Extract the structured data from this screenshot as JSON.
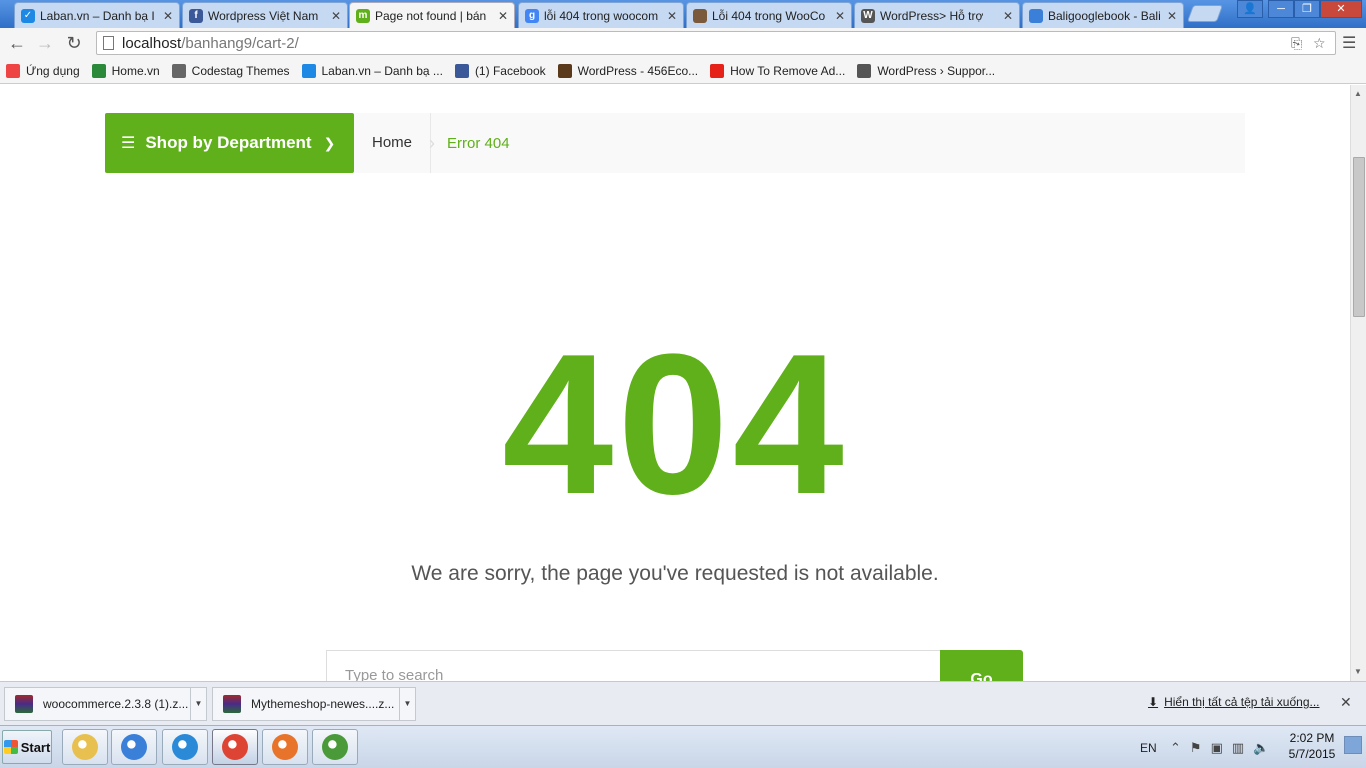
{
  "browser": {
    "tabs": [
      {
        "label": "Laban.vn – Danh bạ I",
        "active": false,
        "icon": "laban-icon",
        "color": "#1e88e5",
        "glyph": "✓"
      },
      {
        "label": "Wordpress Việt Nam",
        "active": false,
        "icon": "facebook-icon",
        "color": "#3b5998",
        "glyph": "f"
      },
      {
        "label": "Page not found | bán",
        "active": true,
        "icon": "m-icon",
        "color": "#5fb01a",
        "glyph": "m"
      },
      {
        "label": "lỗi 404 trong woocom",
        "active": false,
        "icon": "google-icon",
        "color": "#4285f4",
        "glyph": "g"
      },
      {
        "label": "Lỗi 404 trong WooCo",
        "active": false,
        "icon": "avatar-icon",
        "color": "#7a5a3a",
        "glyph": ""
      },
      {
        "label": "WordPress> Hỗ trợ",
        "active": false,
        "icon": "wordpress-icon",
        "color": "#555555",
        "glyph": "W"
      },
      {
        "label": "Baligooglebook - Bali",
        "active": false,
        "icon": "loading-icon",
        "color": "#3a7fd8",
        "glyph": ""
      }
    ],
    "url_host": "localhost",
    "url_path": "/banhang9/cart-2/",
    "bookmarks": [
      {
        "label": "Ứng dụng",
        "icon": "apps-grid-icon",
        "color": "#e44"
      },
      {
        "label": "Home.vn",
        "icon": "home-vn-icon",
        "color": "#2a8a3a"
      },
      {
        "label": "Codestag Themes",
        "icon": "codestag-icon",
        "color": "#666666"
      },
      {
        "label": "Laban.vn – Danh bạ ...",
        "icon": "laban-icon",
        "color": "#1e88e5"
      },
      {
        "label": "(1) Facebook",
        "icon": "facebook-icon",
        "color": "#3b5998"
      },
      {
        "label": "WordPress - 456Eco...",
        "icon": "wordpress-456-icon",
        "color": "#5a3a1a"
      },
      {
        "label": "How To Remove Ad...",
        "icon": "youtube-icon",
        "color": "#e62117"
      },
      {
        "label": "WordPress › Suppor...",
        "icon": "wordpress-icon",
        "color": "#555555"
      }
    ]
  },
  "page": {
    "department_button": "Shop by Department",
    "breadcrumb_home": "Home",
    "breadcrumb_current": "Error 404",
    "error_code": "404",
    "message": "We are sorry, the page you've requested is not available.",
    "search_placeholder": "Type to search",
    "search_button": "Go",
    "accent_color": "#5fb01a"
  },
  "downloads": {
    "items": [
      {
        "label": "woocommerce.2.3.8 (1).z..."
      },
      {
        "label": "Mythemeshop-newes....z..."
      }
    ],
    "show_all": "Hiển thị tất cả tệp tải xuống..."
  },
  "taskbar": {
    "start_label": "Start",
    "apps": [
      {
        "name": "file-explorer-icon",
        "color": "#e8c050"
      },
      {
        "name": "media-player-icon",
        "color": "#3a7fd8"
      },
      {
        "name": "internet-explorer-icon",
        "color": "#2a8ad8"
      },
      {
        "name": "chrome-icon",
        "color": "#dd4433"
      },
      {
        "name": "firefox-icon",
        "color": "#e8732a"
      },
      {
        "name": "notepad-plus-icon",
        "color": "#4a9a3a"
      }
    ],
    "language": "EN",
    "time": "2:02 PM",
    "date": "5/7/2015"
  }
}
